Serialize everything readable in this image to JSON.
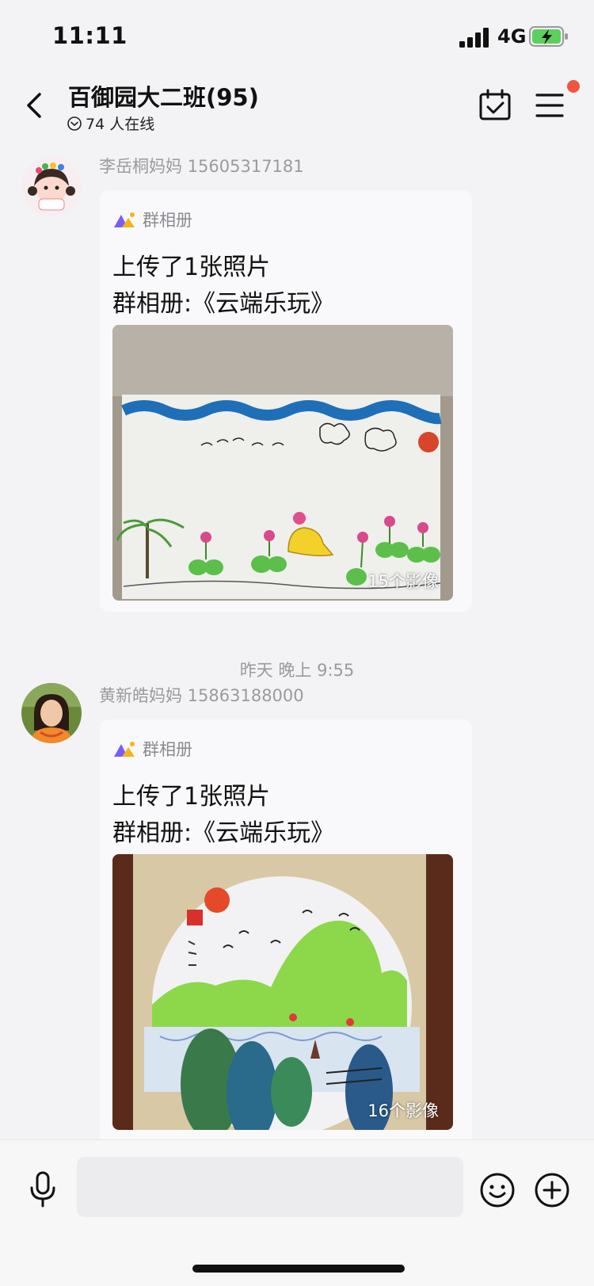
{
  "status_bar": {
    "time": "11:11",
    "network": "4G"
  },
  "header": {
    "title": "百御园大二班(95)",
    "online": "74 人在线"
  },
  "messages": [
    {
      "sender": "李岳桐妈妈 15605317181",
      "tag": "群相册",
      "line1": "上传了1张照片",
      "line2": "群相册:《云端乐玩》",
      "photo_count": "15个影像"
    },
    {
      "sender": "黄新皓妈妈 15863188000",
      "tag": "群相册",
      "line1": "上传了1张照片",
      "line2": "群相册:《云端乐玩》",
      "photo_count": "16个影像"
    }
  ],
  "timestamp": "昨天 晚上 9:55",
  "input_bar": {
    "placeholder": ""
  },
  "colors": {
    "notification_dot": "#f0563f",
    "album_icon_purple": "#7b5cf5",
    "album_icon_yellow": "#f5b21b"
  }
}
